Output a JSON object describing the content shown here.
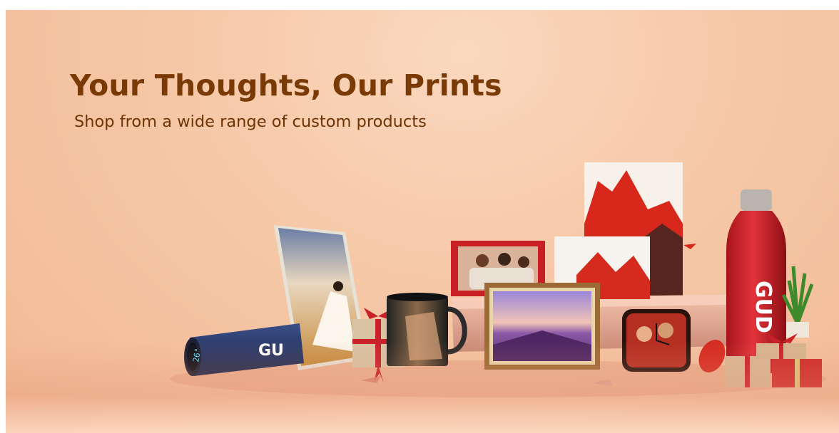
{
  "banner": {
    "headline": "Your Thoughts, Our Prints",
    "subheadline": "Shop from a wide range of custom products",
    "colors": {
      "headline": "#7a3a05",
      "background": "#f6c9a8"
    },
    "products": {
      "thermos_brand": "GU",
      "thermos_temp": "26°",
      "bottle_brand": "GUD"
    }
  }
}
